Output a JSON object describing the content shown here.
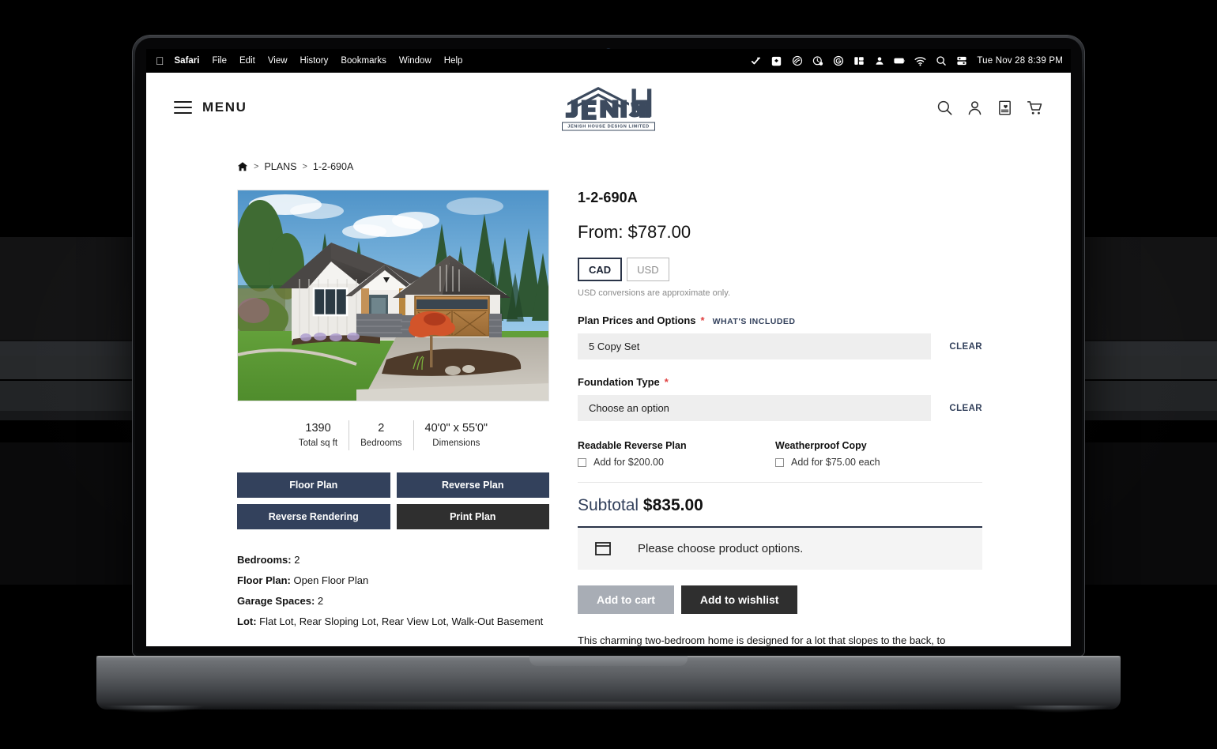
{
  "macos_menubar": {
    "apple_glyph": "",
    "items": [
      {
        "label": "Safari",
        "bold": true
      },
      {
        "label": "File",
        "bold": false
      },
      {
        "label": "Edit",
        "bold": false
      },
      {
        "label": "View",
        "bold": false
      },
      {
        "label": "History",
        "bold": false
      },
      {
        "label": "Bookmarks",
        "bold": false
      },
      {
        "label": "Window",
        "bold": false
      },
      {
        "label": "Help",
        "bold": false
      }
    ],
    "status_icons": [
      "checkmark-icon",
      "dropbox-icon",
      "creative-cloud-icon",
      "clock-badge-icon",
      "grammarly-icon",
      "stage-manager-icon",
      "user-icon",
      "battery-icon",
      "wifi-icon",
      "spotlight-search-icon",
      "control-center-icon"
    ],
    "clock": "Tue Nov 28  8:39 PM"
  },
  "site_header": {
    "menu_label": "MENU",
    "logo_wordmark": "JENISH",
    "logo_tagline": "JENISH HOUSE DESIGN LIMITED",
    "icons": [
      "search-icon",
      "account-icon",
      "wishlist-icon",
      "cart-icon"
    ]
  },
  "breadcrumb": {
    "home_icon": "home-icon",
    "separator": ">",
    "items": [
      "PLANS",
      "1-2-690A"
    ]
  },
  "product": {
    "title": "1-2-690A",
    "price_from": "From: $787.00",
    "currency": {
      "options": [
        {
          "label": "CAD",
          "selected": true
        },
        {
          "label": "USD",
          "selected": false
        }
      ],
      "note": "USD conversions are approximate only."
    },
    "fields": [
      {
        "label": "Plan Prices and Options",
        "required": "*",
        "link": "WHAT'S INCLUDED",
        "value": "5 Copy Set",
        "clear": "CLEAR"
      },
      {
        "label": "Foundation Type",
        "required": "*",
        "link": "",
        "value": "Choose an option",
        "clear": "CLEAR"
      }
    ],
    "addons": [
      {
        "title": "Readable Reverse Plan",
        "option": "Add for  $200.00",
        "checked": false
      },
      {
        "title": "Weatherproof Copy",
        "option": "Add for  $75.00 each",
        "checked": false
      }
    ],
    "subtotal": {
      "label": "Subtotal",
      "value": "$835.00"
    },
    "notice": {
      "icon": "window-frame-icon",
      "text": "Please choose product options."
    },
    "cta": {
      "add_to_cart": "Add to cart",
      "add_to_wishlist": "Add to wishlist"
    },
    "description": "This charming two-bedroom home is designed for a lot that slopes to the back, to"
  },
  "plan_media": {
    "image_alt": "front-elevation-rendering",
    "stats": [
      {
        "value": "1390",
        "label": "Total sq ft"
      },
      {
        "value": "2",
        "label": "Bedrooms"
      },
      {
        "value": "40'0\" x 55'0\"",
        "label": "Dimensions"
      }
    ],
    "buttons": [
      {
        "label": "Floor Plan",
        "style": "navy"
      },
      {
        "label": "Reverse Plan",
        "style": "navy"
      },
      {
        "label": "Reverse Rendering",
        "style": "navy"
      },
      {
        "label": "Print Plan",
        "style": "dark"
      }
    ],
    "specs": [
      {
        "key": "Bedrooms:",
        "value": "2"
      },
      {
        "key": "Floor Plan:",
        "value": "Open Floor Plan"
      },
      {
        "key": "Garage Spaces:",
        "value": "2"
      },
      {
        "key": "Lot:",
        "value": "Flat Lot, Rear Sloping Lot, Rear View Lot, Walk-Out Basement"
      }
    ]
  },
  "colors": {
    "navy": "#33415c",
    "dark": "#2f2f2f",
    "required_red": "#e04040",
    "field_bg": "#eeeeee",
    "disabled_btn": "#a8adb5"
  }
}
